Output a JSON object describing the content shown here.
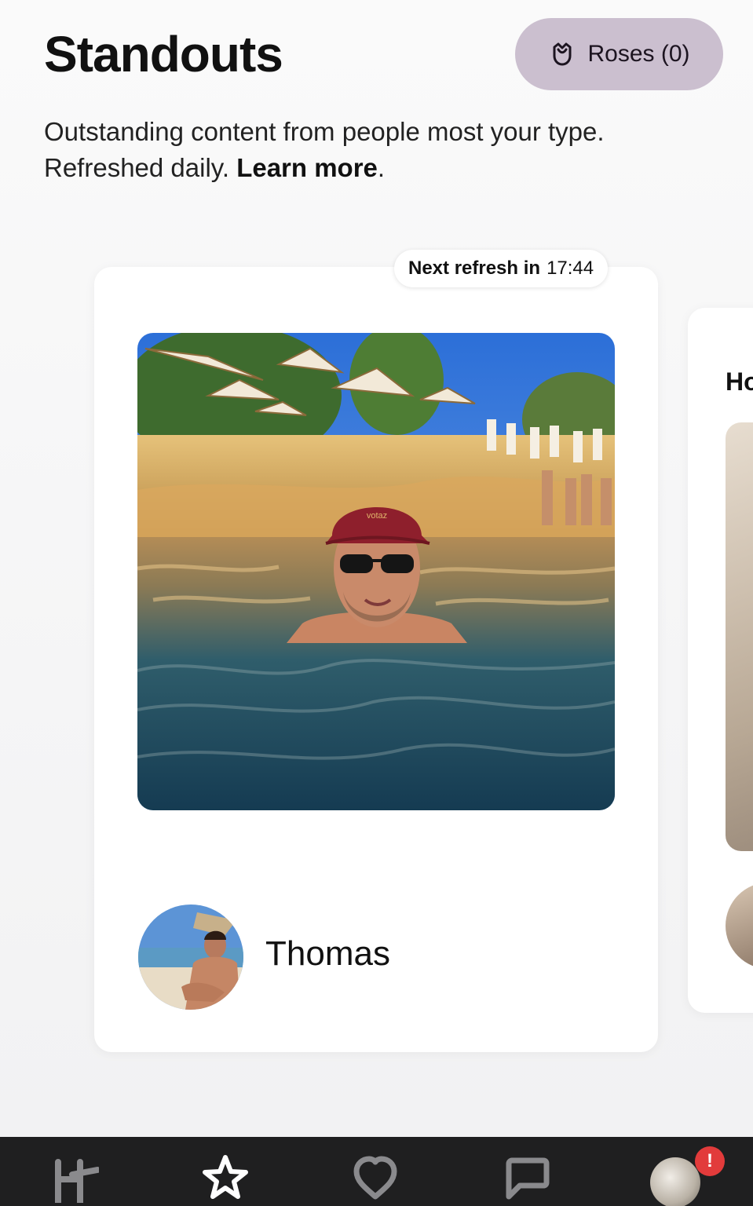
{
  "header": {
    "title": "Standouts",
    "roses_button_label": "Roses (0)",
    "subtitle_text": "Outstanding content from people most your type. Refreshed daily.",
    "learn_more_label": "Learn more",
    "subtitle_end": "."
  },
  "standout_card": {
    "refresh_label": "Next refresh in",
    "refresh_time": "17:44",
    "profile_name": "Thomas",
    "photo_cap_text": "votaz"
  },
  "next_card": {
    "peek_text": "Ho"
  },
  "tabbar": {
    "tabs": [
      {
        "name": "home-tab",
        "icon": "hinge-logo-icon"
      },
      {
        "name": "standouts-tab",
        "icon": "star-icon",
        "active": true
      },
      {
        "name": "likes-tab",
        "icon": "heart-icon"
      },
      {
        "name": "matches-tab",
        "icon": "chat-bubble-icon"
      },
      {
        "name": "profile-tab",
        "icon": "avatar"
      }
    ],
    "profile_badge": "!"
  },
  "colors": {
    "roses_button_bg": "#cbbfcf",
    "tabbar_bg": "#1f1f20",
    "badge_red": "#e23b3b",
    "active_tab": "#ffffff",
    "inactive_tab": "#8a8a8d"
  }
}
